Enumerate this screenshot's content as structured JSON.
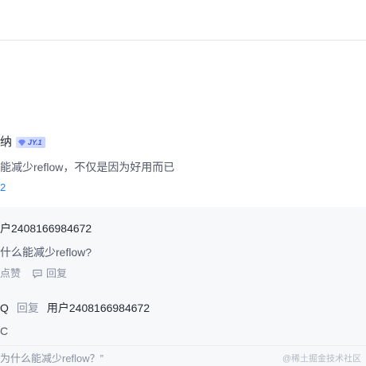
{
  "comment": {
    "username": "纳",
    "level_badge": "JY.1",
    "text": "能减少reflow，不仅是因为好用而已",
    "meta": "2"
  },
  "replies": [
    {
      "username": "户2408166984672",
      "text": "什么能减少reflow?",
      "like_label": "点赞",
      "reply_label": "回复"
    },
    {
      "username": "Q",
      "verb": "回复",
      "target": "用户2408166984672",
      "text": "C"
    }
  ],
  "quote": "为什么能减少reflow？”",
  "watermark": "@稀土掘金技术社区",
  "colors": {
    "link": "#1e80ff",
    "panel_bg": "#f7f8fa",
    "muted": "#8a919f"
  }
}
